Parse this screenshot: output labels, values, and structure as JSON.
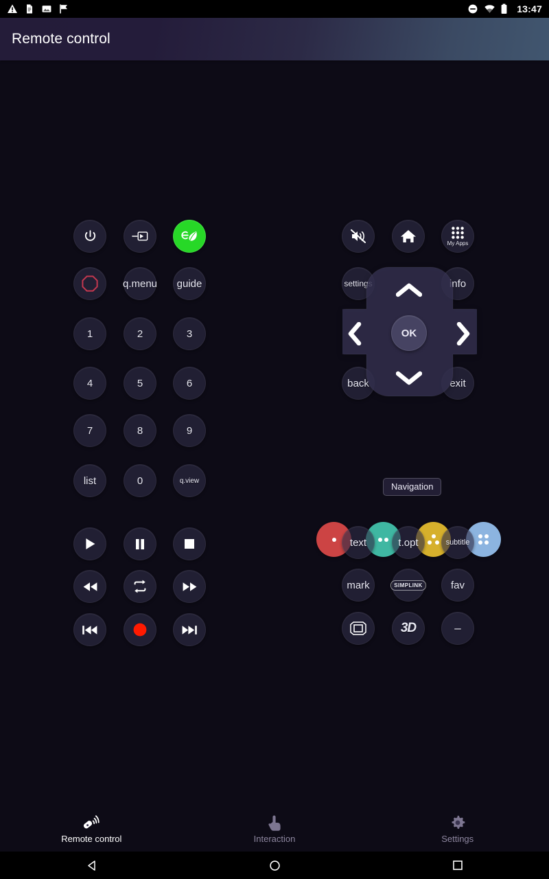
{
  "statusbar": {
    "time": "13:47",
    "left_icons": [
      "warning-icon",
      "document-icon",
      "image-icon",
      "flag-icon"
    ],
    "right_icons": [
      "do-not-disturb-icon",
      "wifi-icon",
      "battery-icon"
    ]
  },
  "titlebar": {
    "title": "Remote control"
  },
  "colors": {
    "accent_green": "#27d827",
    "record_red": "#ff1a00",
    "power_ring_red": "#c4384f",
    "key_red": "#cc4444",
    "key_green": "#3fb7a2",
    "key_yellow": "#d6b02c",
    "key_blue": "#8cb4e0"
  },
  "left_block": {
    "row1": [
      {
        "name": "power-button",
        "icon": "power-icon",
        "label": ""
      },
      {
        "name": "input-source-button",
        "icon": "input-source-icon",
        "label": ""
      },
      {
        "name": "energy-saving-button",
        "icon": "eco-leaf-icon",
        "label": ""
      }
    ],
    "row2": [
      {
        "name": "ratio-ring-button",
        "icon": "red-octagon-ring-icon",
        "label": ""
      },
      {
        "name": "q-menu-button",
        "icon": "",
        "label": "q.menu"
      },
      {
        "name": "guide-button",
        "icon": "",
        "label": "guide"
      }
    ],
    "numpad": [
      {
        "name": "digit-1-button",
        "label": "1"
      },
      {
        "name": "digit-2-button",
        "label": "2"
      },
      {
        "name": "digit-3-button",
        "label": "3"
      },
      {
        "name": "digit-4-button",
        "label": "4"
      },
      {
        "name": "digit-5-button",
        "label": "5"
      },
      {
        "name": "digit-6-button",
        "label": "6"
      },
      {
        "name": "digit-7-button",
        "label": "7"
      },
      {
        "name": "digit-8-button",
        "label": "8"
      },
      {
        "name": "digit-9-button",
        "label": "9"
      },
      {
        "name": "list-button",
        "label": "list"
      },
      {
        "name": "digit-0-button",
        "label": "0"
      },
      {
        "name": "q-view-button",
        "label": "q.view"
      }
    ],
    "media": [
      {
        "name": "play-button",
        "icon": "play-icon"
      },
      {
        "name": "pause-button",
        "icon": "pause-icon"
      },
      {
        "name": "stop-button",
        "icon": "stop-icon"
      },
      {
        "name": "rewind-button",
        "icon": "rewind-icon"
      },
      {
        "name": "repeat-button",
        "icon": "repeat-icon"
      },
      {
        "name": "fast-forward-button",
        "icon": "fast-forward-icon"
      },
      {
        "name": "skip-previous-button",
        "icon": "skip-previous-icon"
      },
      {
        "name": "record-button",
        "icon": "record-icon"
      },
      {
        "name": "skip-next-button",
        "icon": "skip-next-icon"
      }
    ]
  },
  "right_block": {
    "row1": [
      {
        "name": "mute-button",
        "icon": "mute-icon",
        "label": ""
      },
      {
        "name": "home-button",
        "icon": "home-icon",
        "label": ""
      },
      {
        "name": "my-apps-button",
        "icon": "apps-grid-icon",
        "label": "My Apps"
      }
    ],
    "settings_label": "settings",
    "info_label": "info",
    "back_label": "back",
    "exit_label": "exit",
    "ok_label": "OK",
    "navigation_label": "Navigation",
    "color_keys": [
      {
        "name": "color-key-red",
        "color": "#cc4444",
        "dots": 1
      },
      {
        "name": "color-key-green",
        "color": "#3fb7a2",
        "dots": 2
      },
      {
        "name": "color-key-yellow",
        "color": "#d6b02c",
        "dots": 3
      },
      {
        "name": "color-key-blue",
        "color": "#8cb4e0",
        "dots": 4
      }
    ],
    "function_grid": [
      {
        "name": "text-button",
        "label": "text",
        "icon": ""
      },
      {
        "name": "t-opt-button",
        "label": "t.opt",
        "icon": ""
      },
      {
        "name": "subtitle-button",
        "label": "subtitle",
        "icon": ""
      },
      {
        "name": "mark-button",
        "label": "mark",
        "icon": ""
      },
      {
        "name": "simplink-button",
        "label": "SIMPLINK",
        "icon": "simplink-icon"
      },
      {
        "name": "fav-button",
        "label": "fav",
        "icon": ""
      },
      {
        "name": "aspect-ratio-button",
        "label": "",
        "icon": "aspect-ratio-icon"
      },
      {
        "name": "three-d-button",
        "label": "3D",
        "icon": ""
      },
      {
        "name": "dash-button",
        "label": "–",
        "icon": ""
      }
    ]
  },
  "bottomnav": {
    "tabs": [
      {
        "name": "tab-remote-control",
        "label": "Remote control",
        "icon": "remote-signal-icon",
        "active": true
      },
      {
        "name": "tab-interaction",
        "label": "Interaction",
        "icon": "touch-hand-icon",
        "active": false
      },
      {
        "name": "tab-settings",
        "label": "Settings",
        "icon": "gear-icon",
        "active": false
      }
    ]
  },
  "sysnav": {
    "back": "back-triangle-icon",
    "home": "home-circle-icon",
    "recents": "recents-square-icon"
  }
}
